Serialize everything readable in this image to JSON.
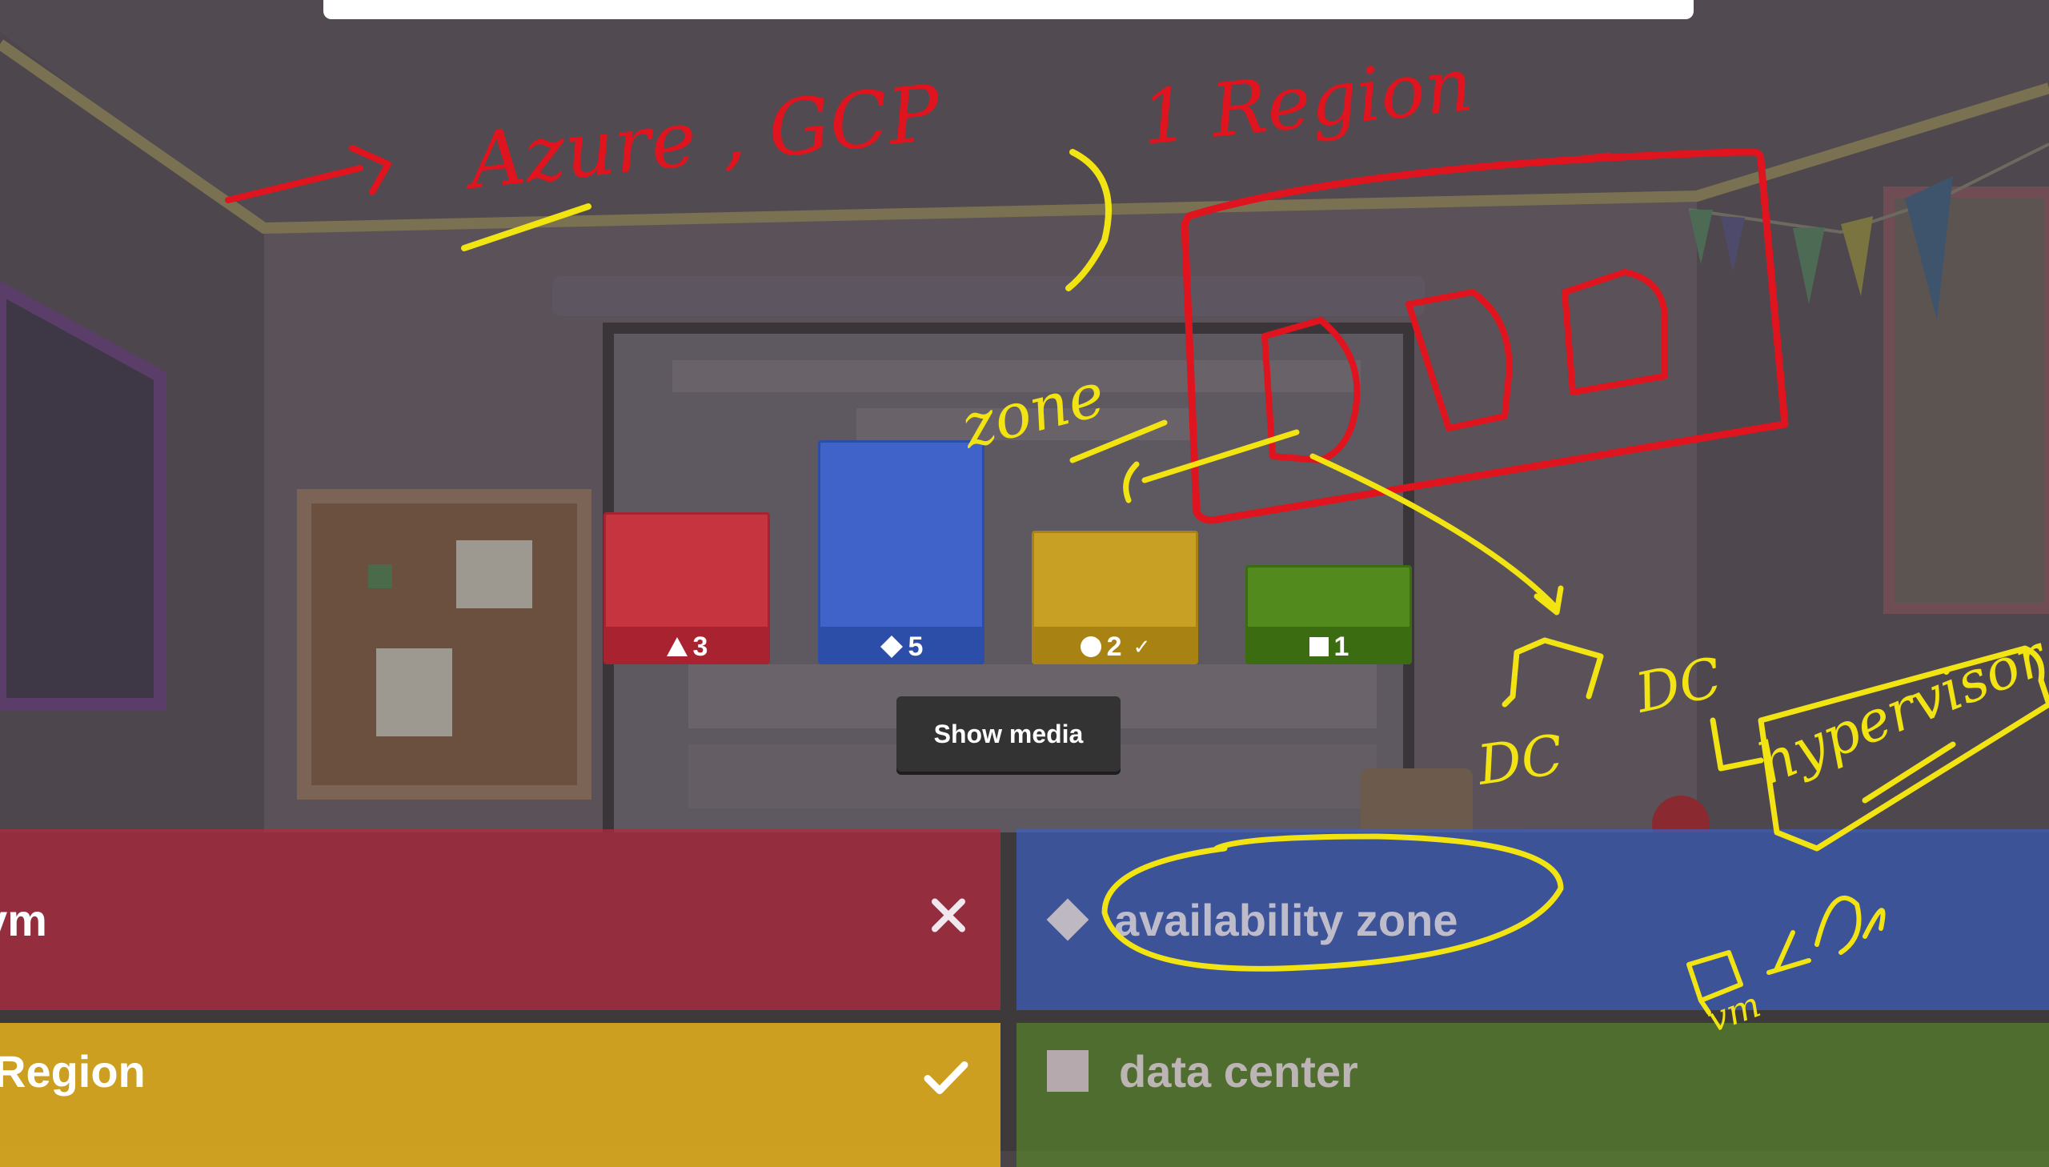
{
  "results": {
    "bars": [
      {
        "shape": "triangle-icon",
        "count": "3",
        "color": "#c5343f",
        "dark": "#a8222f",
        "level": 0.62,
        "correct": false
      },
      {
        "shape": "diamond-icon",
        "count": "5",
        "color": "#3f63c9",
        "dark": "#2d4ea8",
        "level": 1.0,
        "correct": false
      },
      {
        "shape": "circle-icon",
        "count": "2",
        "color": "#c8a023",
        "dark": "#a88314",
        "level": 0.52,
        "correct": true
      },
      {
        "shape": "square-icon",
        "count": "1",
        "color": "#528a1e",
        "dark": "#3c6c12",
        "level": 0.34,
        "correct": false
      }
    ],
    "correct_mark": "✓"
  },
  "show_media_label": "Show media",
  "answers": {
    "red": {
      "text": "vm",
      "shape": "triangle-icon",
      "status": "wrong"
    },
    "blue": {
      "text": "availability zone",
      "shape": "diamond-icon",
      "status": "none"
    },
    "yellow": {
      "text": "Region",
      "shape": "circle-icon",
      "status": "correct"
    },
    "green": {
      "text": "data center",
      "shape": "square-icon",
      "status": "none"
    }
  },
  "annotations": {
    "azure_gcp": "Azure , GCP",
    "region": "1 Region",
    "zone": "zone",
    "dc_left": "DC",
    "dc_right": "DC",
    "hypervisor": "hypervisor",
    "vm": "vm"
  },
  "colors": {
    "ink_red": "#e0141e",
    "ink_yellow": "#f2e313",
    "background": "#4a4448"
  }
}
